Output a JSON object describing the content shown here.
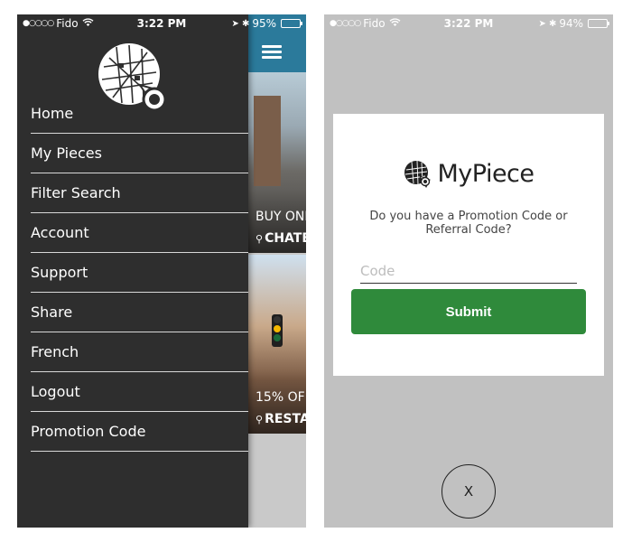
{
  "left_screen": {
    "status": {
      "carrier": "Fido",
      "time": "3:22 PM",
      "battery": "95%",
      "battery_level": 0.95
    },
    "menu": {
      "items": [
        {
          "label": "Home"
        },
        {
          "label": "My Pieces"
        },
        {
          "label": "Filter Search"
        },
        {
          "label": "Account"
        },
        {
          "label": "Support"
        },
        {
          "label": "Share"
        },
        {
          "label": "French"
        },
        {
          "label": "Logout"
        },
        {
          "label": "Promotion Code"
        }
      ]
    },
    "cards": [
      {
        "line1": "BUY ONI",
        "line2": "CHATE"
      },
      {
        "line1": "15% OF",
        "line2": "RESTA"
      }
    ],
    "colors": {
      "drawer_bg": "#2e2e2e",
      "header_bg": "#2b7a9b"
    }
  },
  "right_screen": {
    "status": {
      "carrier": "Fido",
      "time": "3:22 PM",
      "battery": "94%",
      "battery_level": 0.94
    },
    "brand": "MyPiece",
    "prompt": "Do you have a Promotion Code or Referral Code?",
    "input": {
      "placeholder": "Code",
      "value": ""
    },
    "submit_label": "Submit",
    "close_label": "X",
    "colors": {
      "submit_bg": "#2f8a3b",
      "overlay_bg": "#c1c1c1"
    }
  }
}
